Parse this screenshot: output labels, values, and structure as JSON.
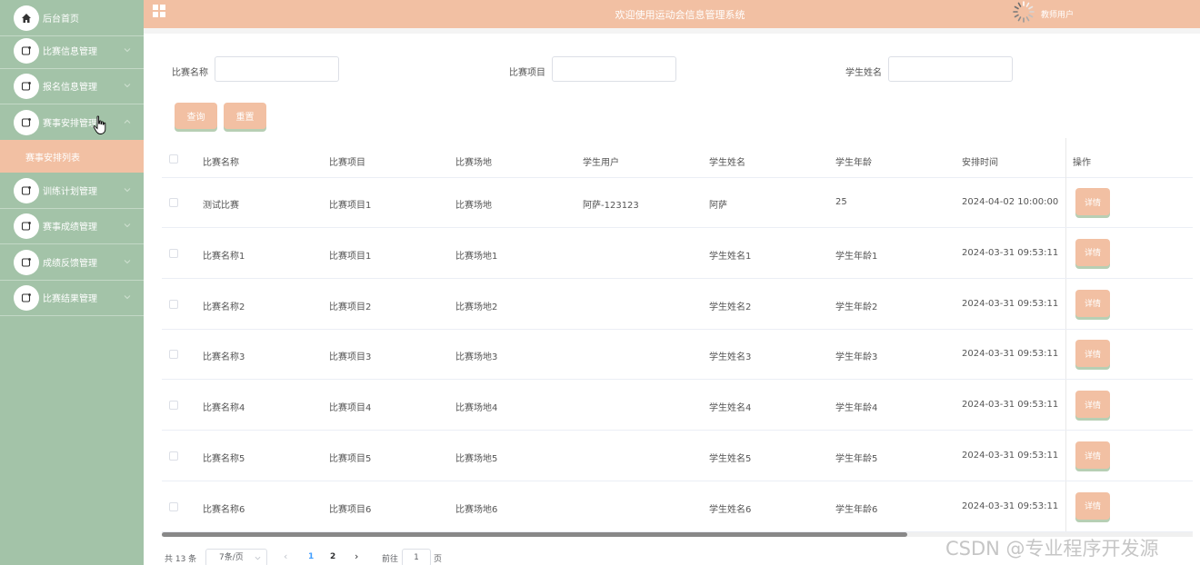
{
  "sidebar": {
    "items": [
      {
        "label": "后台首页",
        "icon": "home-icon"
      },
      {
        "label": "比赛信息管理",
        "icon": "menu-icon"
      },
      {
        "label": "报名信息管理",
        "icon": "menu-icon"
      },
      {
        "label": "赛事安排管理",
        "icon": "menu-icon"
      },
      {
        "label": "训练计划管理",
        "icon": "menu-icon"
      },
      {
        "label": "赛事成绩管理",
        "icon": "menu-icon"
      },
      {
        "label": "成绩反馈管理",
        "icon": "menu-icon"
      },
      {
        "label": "比赛结果管理",
        "icon": "menu-icon"
      }
    ],
    "submenu": {
      "label": "赛事安排列表"
    }
  },
  "header": {
    "title": "欢迎使用运动会信息管理系统",
    "user": "教师用户"
  },
  "search": {
    "fields": [
      {
        "label": "比赛名称",
        "value": ""
      },
      {
        "label": "比赛项目",
        "value": ""
      },
      {
        "label": "学生姓名",
        "value": ""
      }
    ],
    "query_label": "查询",
    "reset_label": "重置"
  },
  "table": {
    "columns": [
      "比赛名称",
      "比赛项目",
      "比赛场地",
      "学生用户",
      "学生姓名",
      "学生年龄",
      "安排时间",
      "操作"
    ],
    "rows": [
      [
        "测试比赛",
        "比赛项目1",
        "比赛场地",
        "阿萨-123123",
        "阿萨",
        "25",
        "2024-04-02 10:00:00"
      ],
      [
        "比赛名称1",
        "比赛项目1",
        "比赛场地1",
        "",
        "学生姓名1",
        "学生年龄1",
        "2024-03-31 09:53:11"
      ],
      [
        "比赛名称2",
        "比赛项目2",
        "比赛场地2",
        "",
        "学生姓名2",
        "学生年龄2",
        "2024-03-31 09:53:11"
      ],
      [
        "比赛名称3",
        "比赛项目3",
        "比赛场地3",
        "",
        "学生姓名3",
        "学生年龄3",
        "2024-03-31 09:53:11"
      ],
      [
        "比赛名称4",
        "比赛项目4",
        "比赛场地4",
        "",
        "学生姓名4",
        "学生年龄4",
        "2024-03-31 09:53:11"
      ],
      [
        "比赛名称5",
        "比赛项目5",
        "比赛场地5",
        "",
        "学生姓名5",
        "学生年龄5",
        "2024-03-31 09:53:11"
      ],
      [
        "比赛名称6",
        "比赛项目6",
        "比赛场地6",
        "",
        "学生姓名6",
        "学生年龄6",
        "2024-03-31 09:53:11"
      ]
    ],
    "detail_label": "详情"
  },
  "pagination": {
    "total": "共 13 条",
    "page_size": "7条/页",
    "pages": [
      "1",
      "2"
    ],
    "current": "1",
    "goto_label": "前往",
    "goto_value": "1",
    "page_unit": "页",
    "prev": "‹",
    "next": "›"
  },
  "watermark": "CSDN @专业程序开发源",
  "colors": {
    "sidebar": "#a3c3a8",
    "accent": "#f2c0a3",
    "active_page": "#409eff"
  }
}
